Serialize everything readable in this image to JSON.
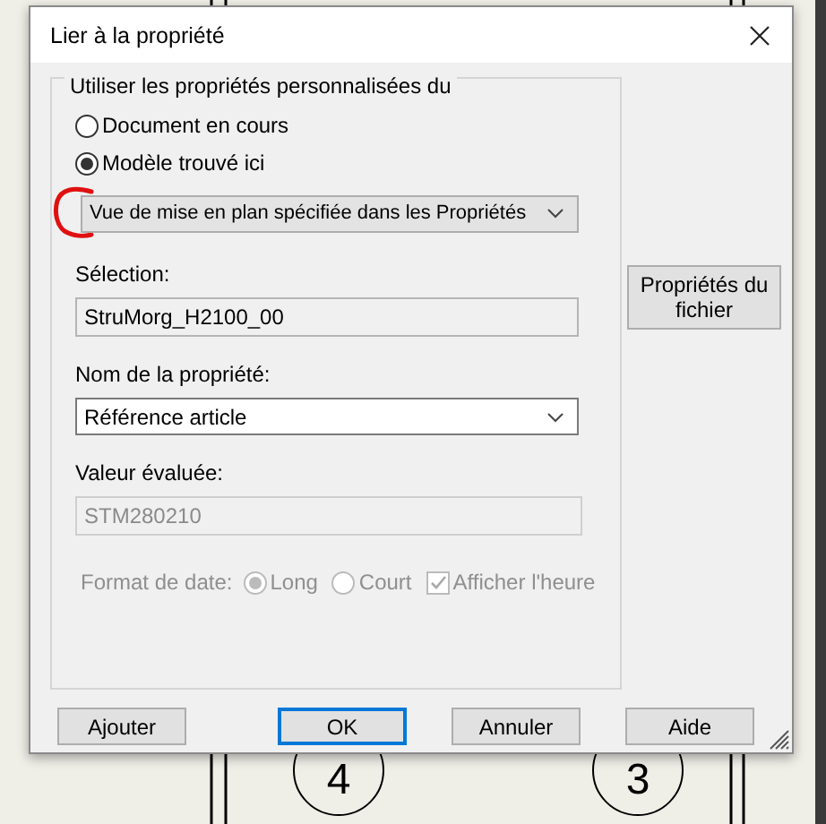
{
  "background": {
    "labels": [
      "4",
      "3"
    ]
  },
  "window": {
    "title": "Lier à la propriété"
  },
  "group": {
    "legend": "Utiliser les propriétés personnalisées du",
    "sources": [
      {
        "label": "Document en cours",
        "selected": false
      },
      {
        "label": "Modèle trouvé ici",
        "selected": true
      }
    ],
    "view_dropdown": {
      "value": "Vue de mise en plan spécifiée dans les Propriétés"
    },
    "selection": {
      "label": "Sélection:",
      "value": "StruMorg_H2100_00"
    },
    "property_name": {
      "label": "Nom de la propriété:",
      "value": "Référence article"
    },
    "evaluated_value": {
      "label": "Valeur évaluée:",
      "value": "STM280210",
      "disabled": true
    },
    "date_format": {
      "label": "Format de date:",
      "disabled": true,
      "options": [
        {
          "label": "Long",
          "selected": true
        },
        {
          "label": "Court",
          "selected": false
        }
      ],
      "show_time": {
        "label": "Afficher l'heure",
        "checked": true
      }
    }
  },
  "file_properties_button": "Propriétés du fichier",
  "buttons": [
    {
      "label": "Ajouter",
      "default": false
    },
    {
      "label": "OK",
      "default": true
    },
    {
      "label": "Annuler",
      "default": false
    },
    {
      "label": "Aide",
      "default": false
    }
  ]
}
